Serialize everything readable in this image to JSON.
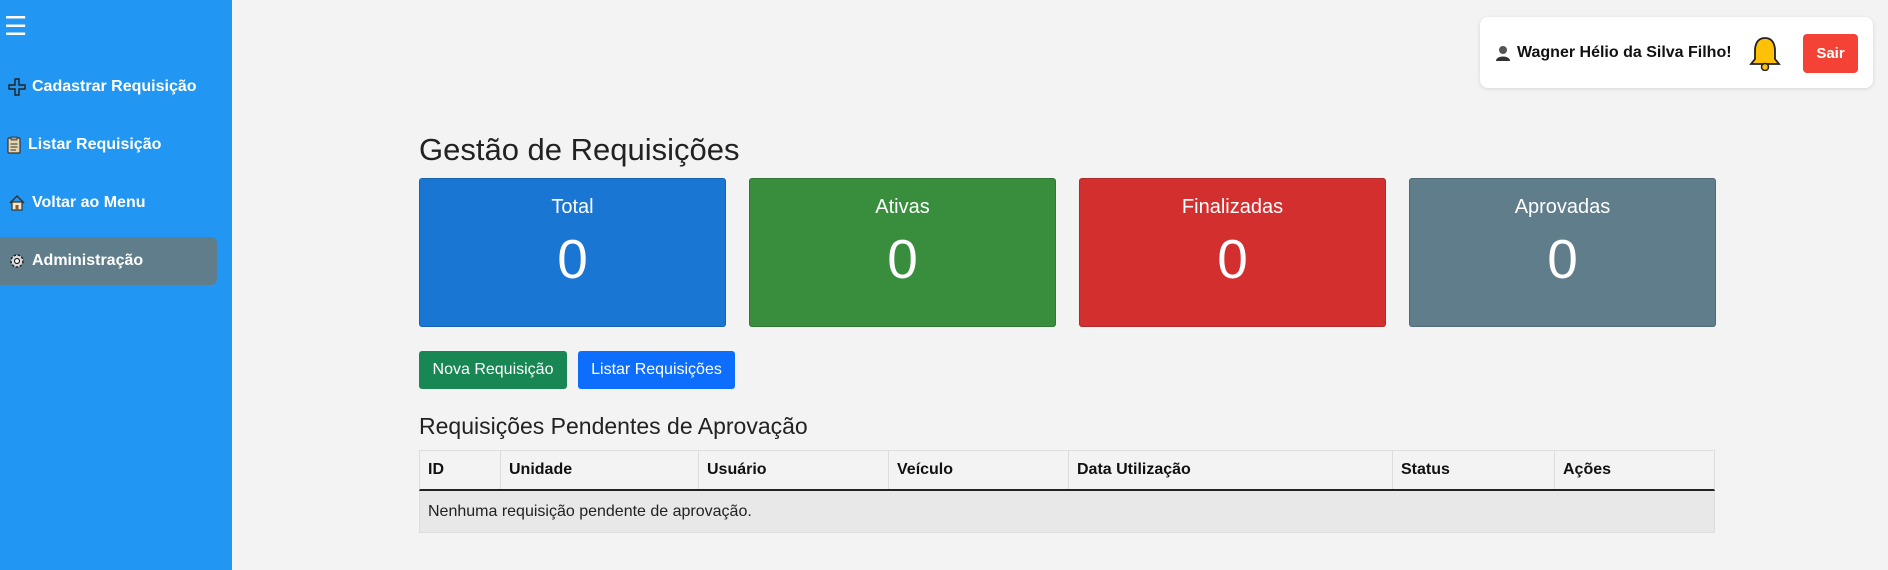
{
  "sidebar": {
    "menu_icon": "☰",
    "items": [
      {
        "label": "Cadastrar Requisição",
        "icon": "plus-icon"
      },
      {
        "label": "Listar Requisição",
        "icon": "clipboard-icon"
      },
      {
        "label": "Voltar ao Menu",
        "icon": "house-icon"
      },
      {
        "label": "Administração",
        "icon": "gear-icon",
        "active": true
      }
    ]
  },
  "header": {
    "user_name": "Wagner Hélio da Silva Filho!",
    "logout_label": "Sair"
  },
  "main": {
    "title": "Gestão de Requisições",
    "stats": [
      {
        "label": "Total",
        "value": "0",
        "color": "#1976d2"
      },
      {
        "label": "Ativas",
        "value": "0",
        "color": "#388e3c"
      },
      {
        "label": "Finalizadas",
        "value": "0",
        "color": "#d32f2f"
      },
      {
        "label": "Aprovadas",
        "value": "0",
        "color": "#607d8b"
      }
    ],
    "buttons": {
      "new_label": "Nova Requisição",
      "list_label": "Listar Requisições"
    },
    "pending": {
      "title": "Requisições Pendentes de Aprovação",
      "columns": [
        "ID",
        "Unidade",
        "Usuário",
        "Veículo",
        "Data Utilização",
        "Status",
        "Ações"
      ],
      "empty_message": "Nenhuma requisição pendente de aprovação."
    }
  },
  "colors": {
    "sidebar_bg": "#2196f3",
    "active_item": "#607d8b",
    "logout": "#f44336",
    "new_button": "#198754",
    "list_button": "#0d6efd"
  }
}
